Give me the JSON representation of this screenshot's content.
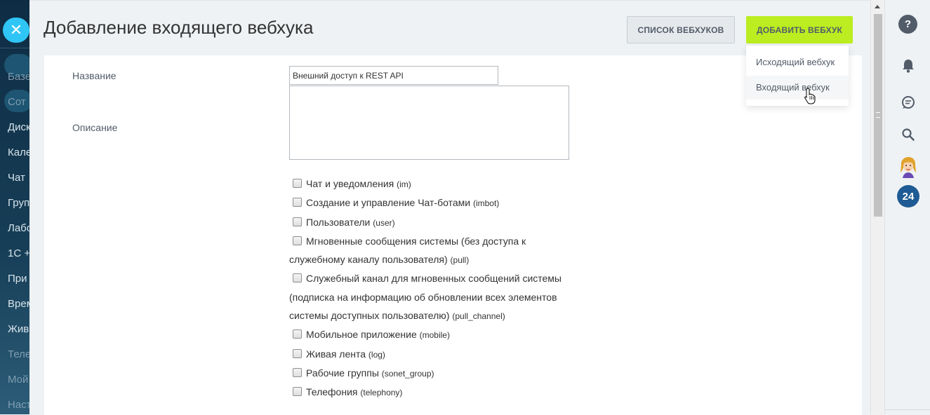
{
  "left_nav": {
    "items": [
      "Базе",
      "Сот",
      "Диск",
      "Кале",
      "Чат",
      "Груп",
      "Лабо",
      "1С +",
      "При",
      "Врем",
      "Жив",
      "Теле",
      "Мой",
      "Наст"
    ]
  },
  "header": {
    "title": "Добавление входящего вебхука",
    "list_button": "СПИСОК ВЕБХУКОВ",
    "add_button": "ДОБАВИТЬ ВЕБХУК"
  },
  "dropdown": {
    "items": [
      "Исходящий вебхук",
      "Входящий вебхук"
    ],
    "hovered_index": 1
  },
  "form": {
    "name_label": "Название",
    "name_value": "Внешний доступ к REST API",
    "description_label": "Описание",
    "description_value": "",
    "scopes": [
      {
        "text": "Чат и уведомления",
        "code": "(im)",
        "checked": false
      },
      {
        "text": "Создание и управление Чат-ботами",
        "code": "(imbot)",
        "checked": false
      },
      {
        "text": "Пользователи",
        "code": "(user)",
        "checked": false
      },
      {
        "text": "Мгновенные сообщения системы (без доступа к служебному каналу пользователя)",
        "code": "(pull)",
        "checked": false
      },
      {
        "text": "Служебный канал для мгновенных сообщений системы (подписка на информацию об обновлении всех элементов системы доступных пользователю)",
        "code": "(pull_channel)",
        "checked": false
      },
      {
        "text": "Мобильное приложение",
        "code": "(mobile)",
        "checked": false
      },
      {
        "text": "Живая лента",
        "code": "(log)",
        "checked": false
      },
      {
        "text": "Рабочие группы",
        "code": "(sonet_group)",
        "checked": false
      },
      {
        "text": "Телефония",
        "code": "(telephony)",
        "checked": false
      }
    ]
  },
  "right_bar": {
    "help_glyph": "?",
    "b24_badge": "24"
  },
  "colors": {
    "accent_green": "#bbed21",
    "close_button": "#2fc6f6",
    "sidebar_dark": "#0e2d44",
    "b24_blue": "#1e5b94"
  }
}
